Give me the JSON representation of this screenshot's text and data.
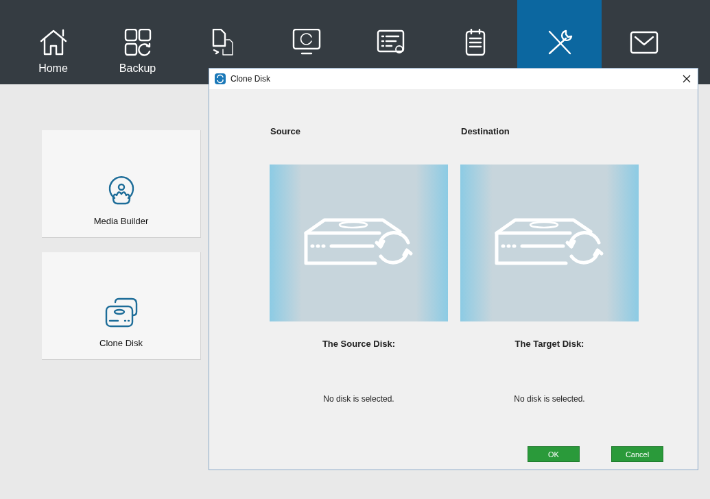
{
  "nav": [
    {
      "kind": "home",
      "label": "Home",
      "selected": false
    },
    {
      "kind": "backup",
      "label": "Backup",
      "selected": false
    },
    {
      "kind": "sync",
      "selected": false
    },
    {
      "kind": "restore",
      "selected": false
    },
    {
      "kind": "manage",
      "selected": false
    },
    {
      "kind": "logs",
      "selected": false
    },
    {
      "kind": "tools",
      "selected": true
    },
    {
      "kind": "feedback",
      "selected": false
    }
  ],
  "tools": [
    {
      "kind": "media",
      "label": "Media Builder"
    },
    {
      "kind": "clone",
      "label": "Clone Disk"
    }
  ],
  "dialog": {
    "title": "Clone Disk",
    "panes": [
      {
        "heading": "Source",
        "disk_label": "The Source Disk:",
        "status": "No disk is selected."
      },
      {
        "heading": "Destination",
        "disk_label": "The Target Disk:",
        "status": "No disk is selected."
      }
    ],
    "buttons": [
      "OK",
      "Cancel"
    ]
  }
}
